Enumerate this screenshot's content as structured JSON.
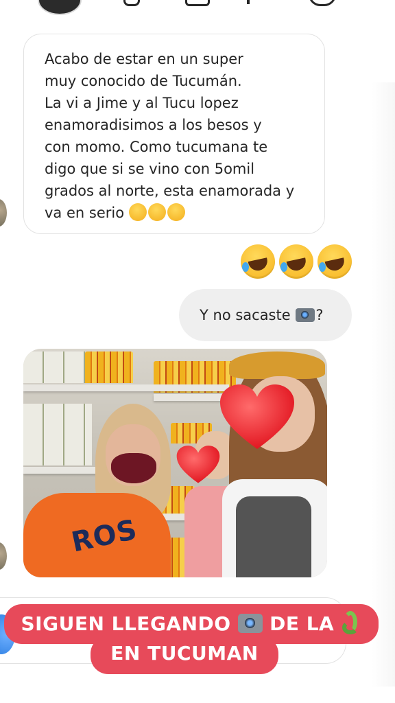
{
  "received_message": {
    "text": "Acabo de estar en un super\nmuy conocido de Tucumán.\nLa vi a Jime y al Tucu lopez\nenamoradisimos a los besos y\ncon momo. Como tucumana te\ndigo que si se vino con 5omil\ngrados al norte, esta enamorada y\nva en serio",
    "trailing_emojis": [
      "grinning-squinting-face",
      "grinning-squinting-face",
      "face-with-hand-over-mouth"
    ]
  },
  "reaction_emojis": [
    "rolling-on-floor-laughing",
    "rolling-on-floor-laughing",
    "rolling-on-floor-laughing"
  ],
  "sent_message": {
    "text": "Y no sacaste",
    "emoji": "camera-with-flash",
    "suffix": "?"
  },
  "photo": {
    "shirt_text": "ROS"
  },
  "caption": {
    "line1_pre": "SIGUEN LLEGANDO",
    "line1_mid": "DE LA",
    "line2": "EN TUCUMAN",
    "emoji1": "camera-with-flash",
    "emoji2": "snake",
    "background_color": "#e74a5a",
    "text_color": "#ffffff"
  }
}
